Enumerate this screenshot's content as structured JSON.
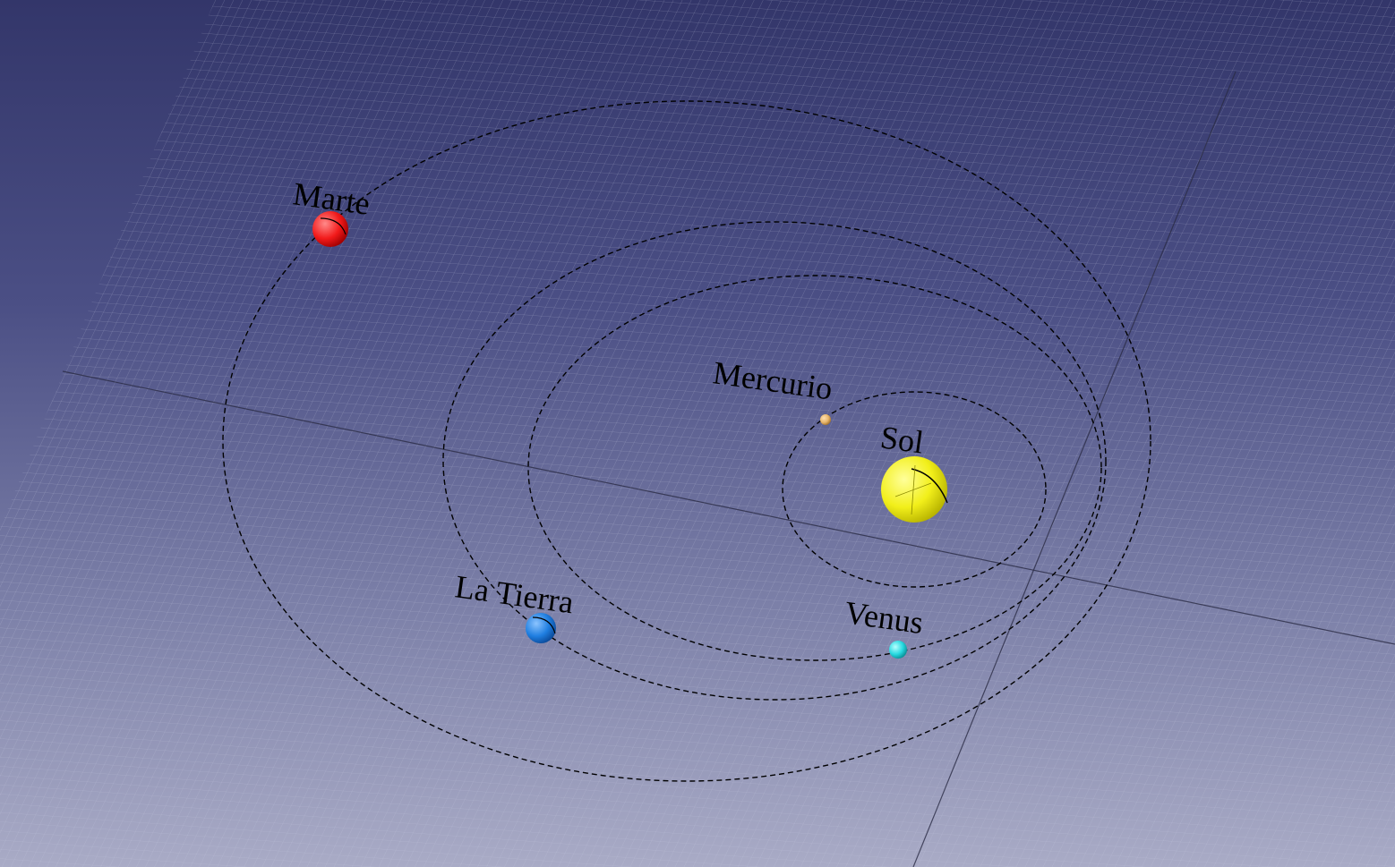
{
  "scene": {
    "colors": {
      "background_top": "#33366a",
      "background_bottom": "#a9abc6",
      "grid_line": "#c8cbe0",
      "orbit": "#000000"
    },
    "bodies": [
      {
        "id": "sol",
        "label": "Sol",
        "color": "#f2ef1a"
      },
      {
        "id": "mercurio",
        "label": "Mercurio",
        "color": "#e8b56a"
      },
      {
        "id": "venus",
        "label": "Venus",
        "color": "#27d9e0"
      },
      {
        "id": "tierra",
        "label": "La Tierra",
        "color": "#1f7ee0"
      },
      {
        "id": "marte",
        "label": "Marte",
        "color": "#f21a1a"
      }
    ]
  }
}
